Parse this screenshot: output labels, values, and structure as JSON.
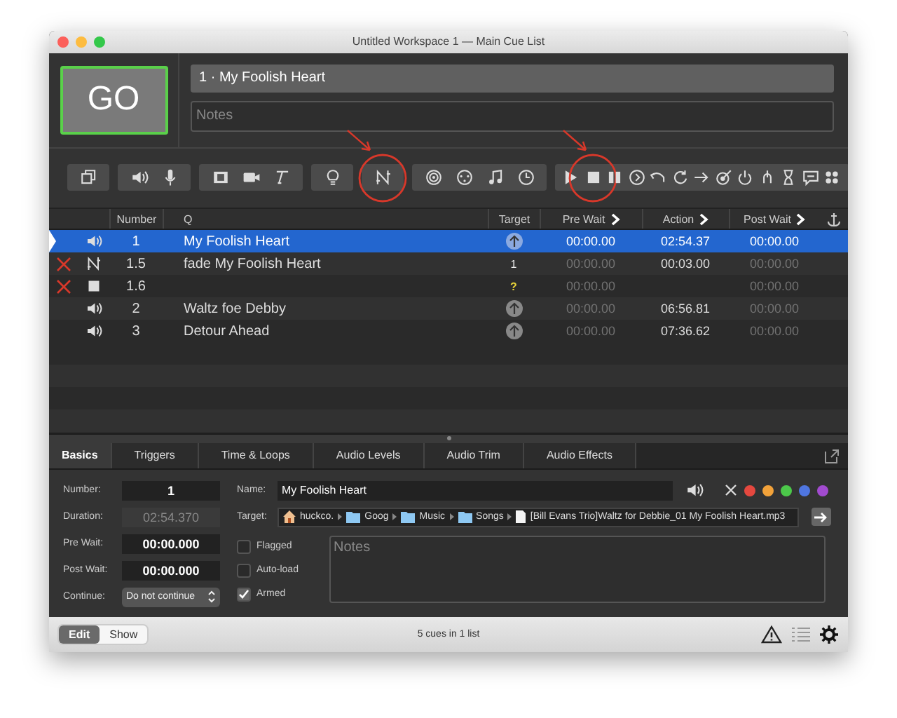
{
  "window": {
    "title": "Untitled Workspace 1 — Main Cue List"
  },
  "go_button": {
    "label": "GO"
  },
  "cue_name": "1 · My Foolish Heart",
  "notes": {
    "placeholder": "Notes"
  },
  "toolbar": [
    {
      "buttons": [
        {
          "kind": "group",
          "highlighted": false
        }
      ]
    },
    {
      "buttons": [
        {
          "kind": "audio",
          "highlighted": false
        },
        {
          "kind": "mic",
          "highlighted": false
        }
      ]
    },
    {
      "buttons": [
        {
          "kind": "video",
          "highlighted": false
        },
        {
          "kind": "camera",
          "highlighted": false
        },
        {
          "kind": "text",
          "highlighted": false
        }
      ]
    },
    {
      "buttons": [
        {
          "kind": "light",
          "highlighted": false
        }
      ]
    },
    {
      "buttons": [
        {
          "kind": "fade",
          "highlighted": true
        }
      ]
    },
    {
      "buttons": [
        {
          "kind": "network",
          "highlighted": false
        },
        {
          "kind": "midi",
          "highlighted": false
        },
        {
          "kind": "music",
          "highlighted": false
        },
        {
          "kind": "clock",
          "highlighted": false
        }
      ]
    },
    {
      "buttons": [
        {
          "kind": "start",
          "highlighted": false
        },
        {
          "kind": "stop",
          "highlighted": true
        },
        {
          "kind": "pause",
          "highlighted": false
        },
        {
          "kind": "goto",
          "highlighted": false
        },
        {
          "kind": "undo",
          "highlighted": false
        },
        {
          "kind": "reset",
          "highlighted": false
        },
        {
          "kind": "arrow",
          "highlighted": false
        },
        {
          "kind": "dart",
          "highlighted": false
        },
        {
          "kind": "power",
          "highlighted": false
        },
        {
          "kind": "disarm",
          "highlighted": false
        },
        {
          "kind": "hourglass",
          "highlighted": false
        },
        {
          "kind": "memo",
          "highlighted": false
        },
        {
          "kind": "dots",
          "highlighted": false
        }
      ]
    }
  ],
  "table": {
    "columns": [
      "Number",
      "Q",
      "Target",
      "Pre Wait",
      "Action",
      "Post Wait"
    ],
    "rows": [
      {
        "kind": "audio",
        "playhead": true,
        "broken": false,
        "selected": true,
        "number": "1",
        "q": "My Foolish Heart",
        "target": {
          "kind": "arrow"
        },
        "pre_wait": {
          "text": "00:00.00",
          "dimmed": false
        },
        "action": "02:54.37",
        "post_wait": {
          "text": "00:00.00",
          "dimmed": false
        }
      },
      {
        "kind": "fade",
        "playhead": false,
        "broken": true,
        "selected": false,
        "number": "1.5",
        "q": "fade My Foolish Heart",
        "target": {
          "kind": "text",
          "text": "1",
          "warning": false
        },
        "pre_wait": {
          "text": "00:00.00",
          "dimmed": true
        },
        "action": "00:03.00",
        "post_wait": {
          "text": "00:00.00",
          "dimmed": true
        }
      },
      {
        "kind": "stop",
        "playhead": false,
        "broken": true,
        "selected": false,
        "number": "1.6",
        "target": {
          "kind": "text",
          "text": "?",
          "warning": true
        },
        "pre_wait": {
          "text": "00:00.00",
          "dimmed": true
        },
        "post_wait": {
          "text": "00:00.00",
          "dimmed": true
        }
      },
      {
        "kind": "audio",
        "playhead": false,
        "broken": false,
        "selected": false,
        "number": "2",
        "q": "Waltz foe Debby",
        "target": {
          "kind": "arrow"
        },
        "pre_wait": {
          "text": "00:00.00",
          "dimmed": true
        },
        "action": "06:56.81",
        "post_wait": {
          "text": "00:00.00",
          "dimmed": true
        }
      },
      {
        "kind": "audio",
        "playhead": false,
        "broken": false,
        "selected": false,
        "number": "3",
        "q": "Detour Ahead",
        "target": {
          "kind": "arrow"
        },
        "pre_wait": {
          "text": "00:00.00",
          "dimmed": true
        },
        "action": "07:36.62",
        "post_wait": {
          "text": "00:00.00",
          "dimmed": true
        }
      }
    ]
  },
  "inspector": {
    "tabs": [
      {
        "label": "Basics",
        "selected": true
      },
      {
        "label": "Triggers",
        "selected": false
      },
      {
        "label": "Time & Loops",
        "selected": false
      },
      {
        "label": "Audio Levels",
        "selected": false
      },
      {
        "label": "Audio Trim",
        "selected": false
      },
      {
        "label": "Audio Effects",
        "selected": false
      }
    ],
    "fields": [
      {
        "label": "Number:",
        "value": "1",
        "disabled": false
      },
      {
        "label": "Duration:",
        "value": "02:54.370",
        "disabled": true
      },
      {
        "label": "Pre Wait:",
        "value": "00:00.000",
        "disabled": false
      },
      {
        "label": "Post Wait:",
        "value": "00:00.000",
        "disabled": false
      }
    ],
    "continue": {
      "label": "Continue:",
      "value": "Do not continue"
    },
    "name": {
      "label": "Name:",
      "value": "My Foolish Heart"
    },
    "colors": [
      {
        "color": "#e5483f"
      },
      {
        "color": "#f2a23a"
      },
      {
        "color": "#4cc84a"
      },
      {
        "color": "#4f76e0"
      },
      {
        "color": "#a24bd0"
      }
    ],
    "target": {
      "label": "Target:",
      "path": [
        {
          "kind": "home",
          "text": "huckco."
        },
        {
          "kind": "folder",
          "text": "Goog"
        },
        {
          "kind": "folder",
          "text": "Music"
        },
        {
          "kind": "folder",
          "text": "Songs"
        },
        {
          "kind": "file",
          "text": "[Bill Evans Trio]Waltz for Debbie_01 My Foolish Heart.mp3"
        }
      ]
    },
    "checkboxes": [
      {
        "label": "Flagged",
        "checked": false
      },
      {
        "label": "Auto-load",
        "checked": false
      },
      {
        "label": "Armed",
        "checked": true
      }
    ],
    "notes": {
      "placeholder": "Notes"
    }
  },
  "status_bar": {
    "modes": [
      {
        "label": "Edit",
        "selected": true
      },
      {
        "label": "Show",
        "selected": false
      }
    ],
    "text": "5 cues in 1 list"
  }
}
